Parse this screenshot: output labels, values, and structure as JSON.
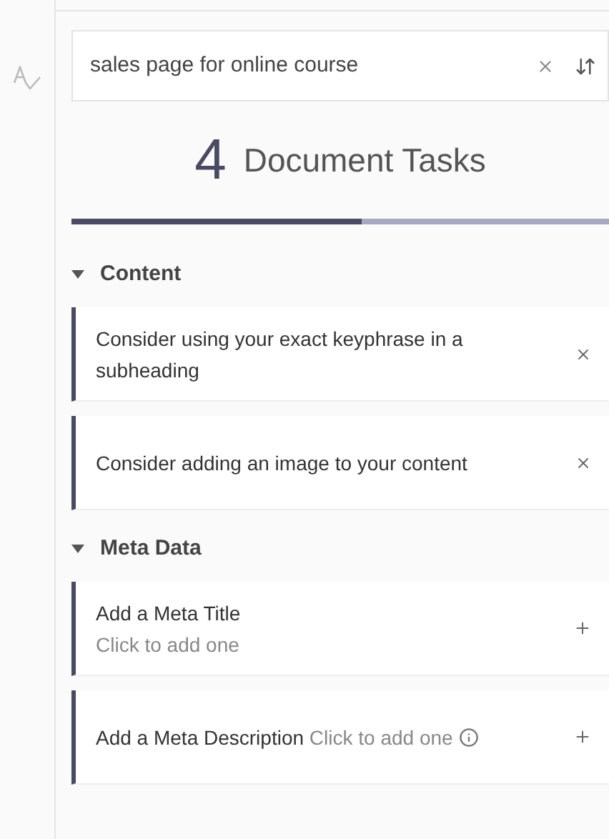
{
  "search": {
    "value": "sales page for online course"
  },
  "summary": {
    "count": "4",
    "label": "Document Tasks",
    "level": 0.54
  },
  "sections": [
    {
      "title": "Content",
      "expanded": true,
      "tasks": [
        {
          "kind": "dismiss",
          "title": "Consider using your exact keyphrase in a subheading"
        },
        {
          "kind": "dismiss",
          "title": "Consider adding an image to your content"
        }
      ]
    },
    {
      "title": "Meta Data",
      "expanded": true,
      "tasks": [
        {
          "kind": "add",
          "title": "Add a Meta Title",
          "hint": "Click to add one",
          "inline": false,
          "info": false
        },
        {
          "kind": "add",
          "title": "Add a Meta Description",
          "hint": "Click to add one",
          "inline": true,
          "info": true
        }
      ]
    }
  ]
}
